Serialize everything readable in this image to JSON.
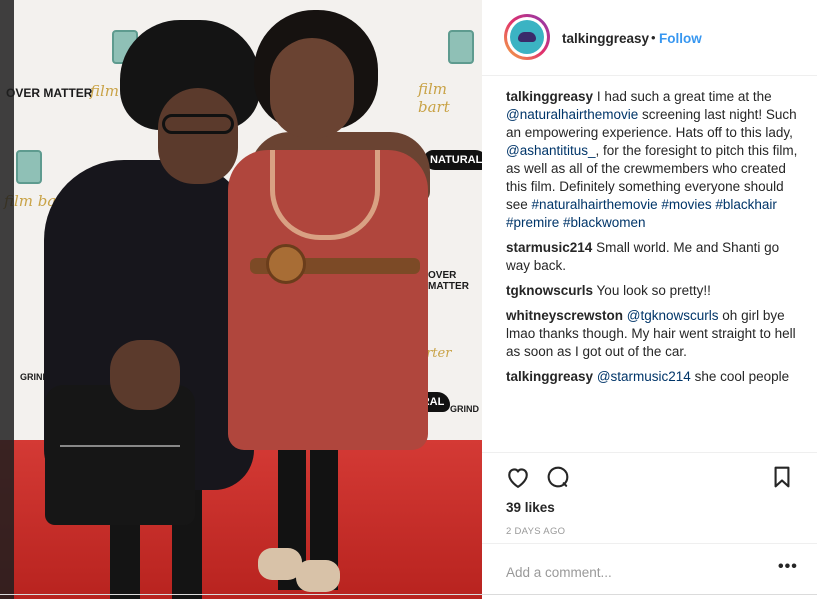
{
  "post": {
    "username": "talkinggreasy",
    "separator": "•",
    "follow_label": "Follow"
  },
  "backdrop_logos": {
    "over_matter": "OVER MATTER",
    "film_bart": "film bart",
    "natural": "NATURAL",
    "grind": "GRIND",
    "bartar": "barter"
  },
  "caption": {
    "user": "talkinggreasy",
    "text_1": "I had such a great time at the",
    "mention_1": "@naturalhairthemovie",
    "text_2": "screening last night! Such an empowering experience. Hats off to this lady,",
    "mention_2": "@ashantititus_",
    "text_3": ", for the foresight to pitch this film, as well as all of the crewmembers who created this film. Definitely something everyone should see",
    "hashtags": "#naturalhairthemovie #movies #blackhair #premire #blackwomen"
  },
  "comments": [
    {
      "user": "starmusic214",
      "text": "Small world. Me and Shanti go way back."
    },
    {
      "user": "tgknowscurls",
      "text": "You look so pretty!!"
    },
    {
      "user": "whitneyscrewston",
      "mention": "@tgknowscurls",
      "text": "oh girl bye lmao thanks though. My hair went straight to hell as soon as I got out of the car."
    },
    {
      "user": "talkinggreasy",
      "mention": "@starmusic214",
      "text": "she cool people"
    }
  ],
  "actions": {
    "like_icon": "heart-icon",
    "comment_icon": "comment-bubble-icon",
    "save_icon": "bookmark-icon",
    "likes": "39 likes",
    "timestamp": "2 DAYS AGO"
  },
  "add_comment": {
    "placeholder": "Add a comment...",
    "more_label": "•••"
  },
  "colors": {
    "link": "#003569",
    "follow": "#3897f0",
    "text": "#262626",
    "muted": "#999999",
    "carpet": "#c72d28"
  }
}
